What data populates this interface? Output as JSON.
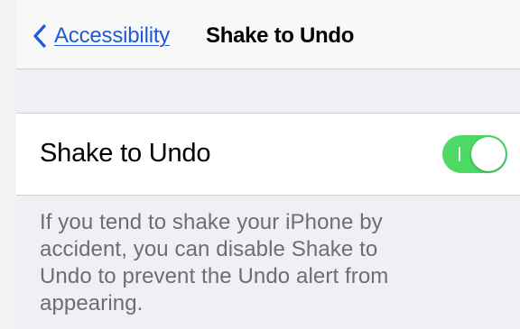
{
  "navbar": {
    "back_label": "Accessibility",
    "title": "Shake to Undo"
  },
  "setting": {
    "label": "Shake to Undo",
    "toggle_state": "on"
  },
  "footer": {
    "text_lines": [
      "If you tend to shake your iPhone by",
      "accident, you can disable Shake to",
      "Undo to prevent the Undo alert from",
      "appearing."
    ]
  },
  "colors": {
    "accent": "#1e5bd6",
    "toggle_on": "#4cd964",
    "background": "#efeff4",
    "footer_text": "#6d6d72"
  },
  "icons": {
    "back": "chevron-left-icon"
  }
}
